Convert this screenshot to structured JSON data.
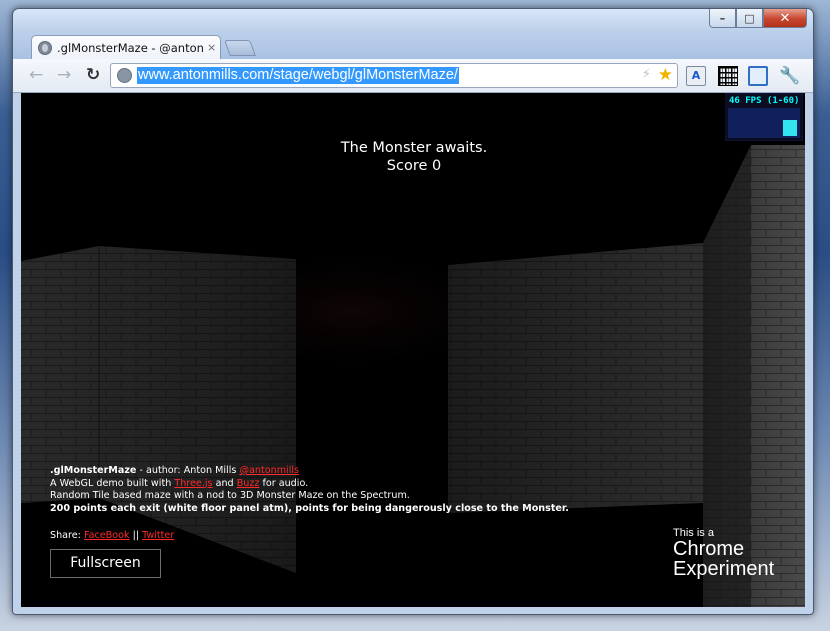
{
  "browser": {
    "tab_title": ".glMonsterMaze - @antonm",
    "tab_close": "×",
    "url": "www.antonmills.com/stage/webgl/glMonsterMaze/",
    "window_controls": {
      "minimize": "–",
      "maximize": "□",
      "close": "✕"
    },
    "nav": {
      "back": "←",
      "forward": "→",
      "reload": "↻"
    },
    "icons": [
      "globe-icon",
      "bolt-icon",
      "star-icon",
      "translate-icon",
      "qr-code-icon",
      "screen-capture-icon",
      "wrench-icon"
    ],
    "translate_label": "A"
  },
  "game": {
    "status_line1": "The Monster awaits.",
    "status_line2": "Score 0",
    "fps": "46 FPS (1-60)"
  },
  "info": {
    "name": ".glMonsterMaze",
    "author_prefix": " - author: Anton Mills ",
    "author_handle": "@antonmills",
    "line2_prefix": "A WebGL demo built with ",
    "threejs": "Three.js",
    "line2_mid": " and ",
    "buzz": "Buzz",
    "line2_suffix": " for audio.",
    "line3": "Random Tile based maze with a nod to 3D Monster Maze on the Spectrum.",
    "line4": "200 points each exit (white floor panel atm), points for being dangerously close to the Monster.",
    "share_label": "Share: ",
    "facebook": "FaceBook",
    "separator": " || ",
    "twitter": "Twitter",
    "fullscreen": "Fullscreen"
  },
  "experiment": {
    "small": "This is a",
    "line1": "Chrome",
    "line2": "Experiment"
  },
  "colors": {
    "link": "#ff2a2a",
    "fps": "#00ffff",
    "url_highlight": "#3399ff"
  }
}
